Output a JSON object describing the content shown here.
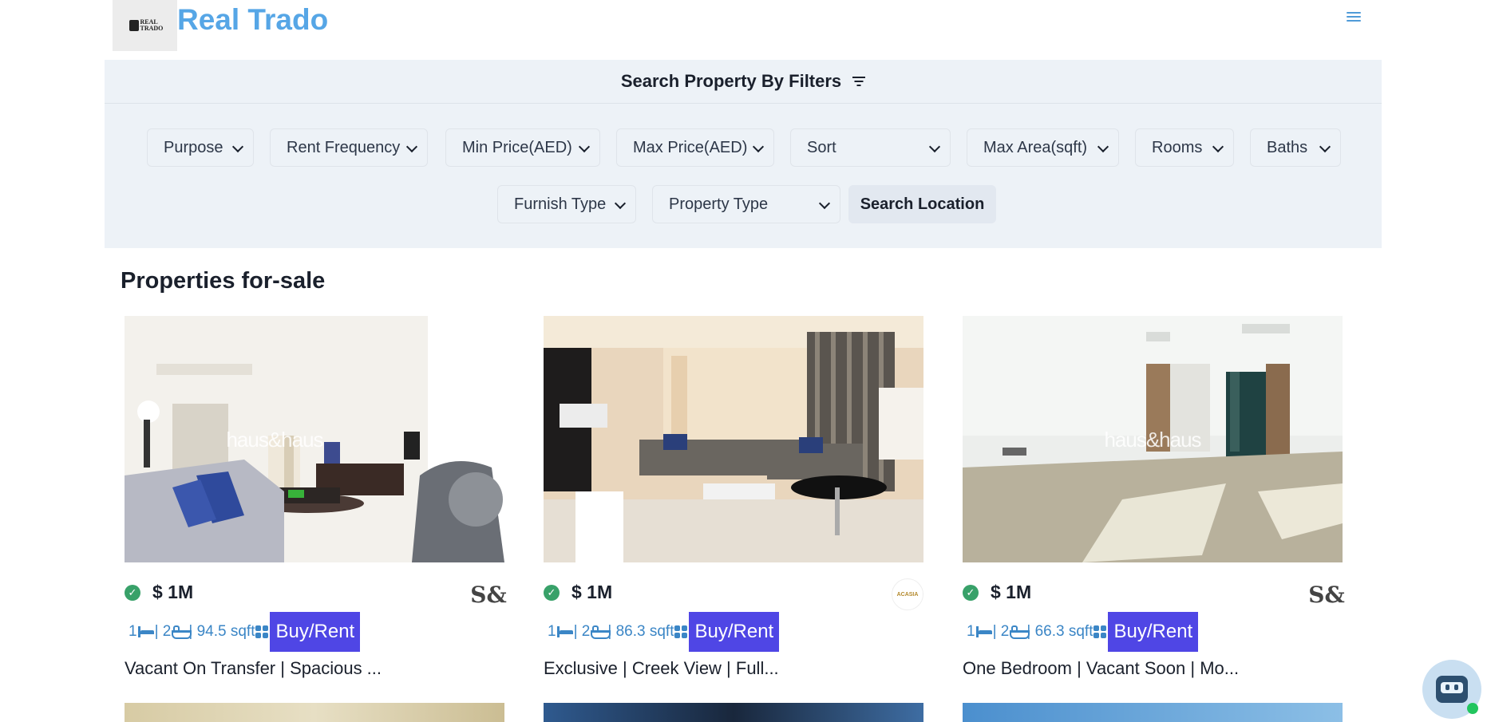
{
  "header": {
    "logo_text": "REAL TRADO",
    "brand": "Real Trado",
    "menu_icon": "hamburger-menu-icon"
  },
  "filters": {
    "title": "Search Property By Filters",
    "selects": [
      {
        "label": "Purpose"
      },
      {
        "label": "Rent Frequency"
      },
      {
        "label": "Min Price(AED)"
      },
      {
        "label": "Max Price(AED)"
      },
      {
        "label": "Sort"
      },
      {
        "label": "Max Area(sqft)"
      },
      {
        "label": "Rooms"
      },
      {
        "label": "Baths"
      },
      {
        "label": "Furnish Type"
      },
      {
        "label": "Property Type"
      }
    ],
    "search_location": "Search Location"
  },
  "section_title": "Properties for-sale",
  "listings": [
    {
      "price": "$ 1M",
      "rooms": "1",
      "baths": "2",
      "area": "94.5 sqft",
      "action": "Buy/Rent",
      "title": "Vacant On Transfer | Spacious ...",
      "watermark": "haus&haus",
      "agency_logo": "S&"
    },
    {
      "price": "$ 1M",
      "rooms": "1",
      "baths": "2",
      "area": "86.3 sqft",
      "action": "Buy/Rent",
      "title": "Exclusive | Creek View | Full...",
      "watermark": "",
      "agency_logo": "ACASIA"
    },
    {
      "price": "$ 1M",
      "rooms": "1",
      "baths": "2",
      "area": "66.3 sqft",
      "action": "Buy/Rent",
      "title": "One Bedroom | Vacant Soon | Mo...",
      "watermark": "haus&haus",
      "agency_logo": "S&"
    }
  ],
  "colors": {
    "brand": "#56a6e6",
    "filter_bg": "#edf2f7",
    "accent_button": "#4f46e5",
    "meta_text": "#3b86c6",
    "verified": "#38a169"
  }
}
